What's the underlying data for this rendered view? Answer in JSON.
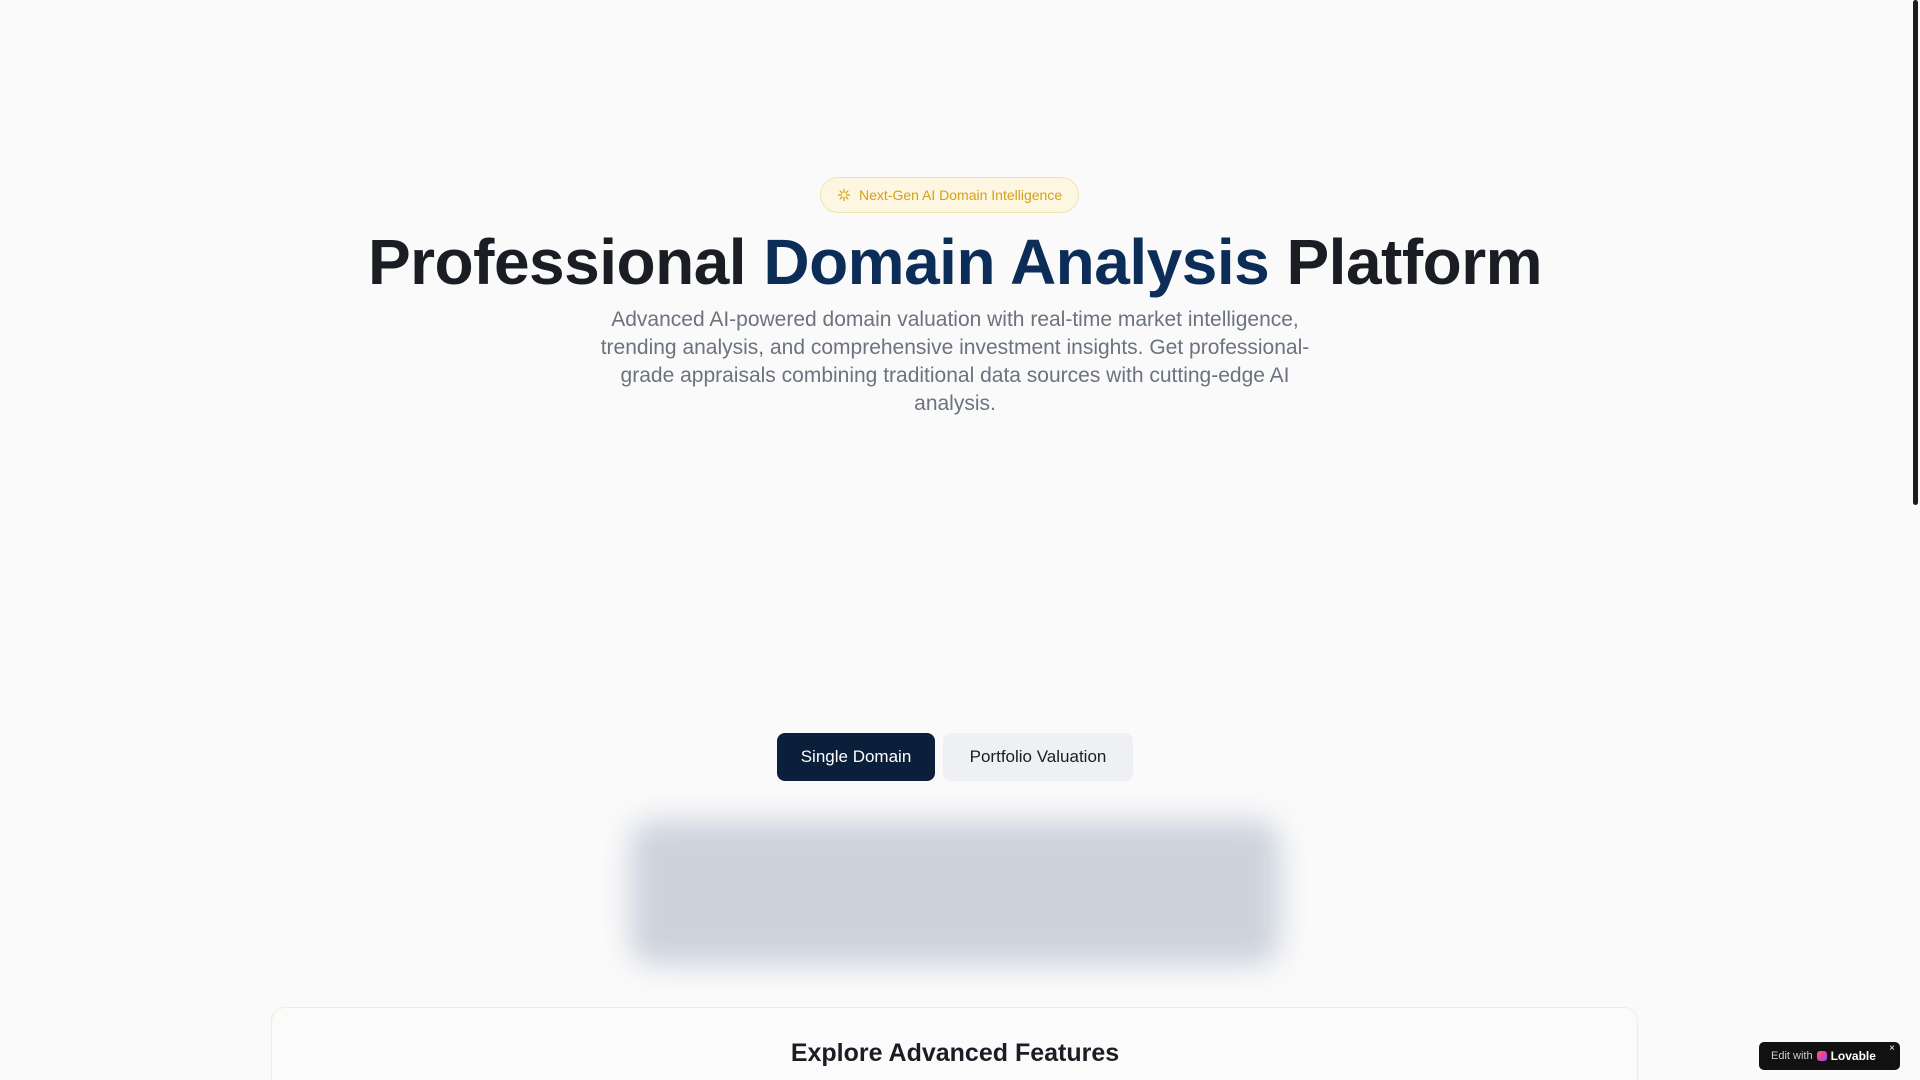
{
  "badge": {
    "label": "Next-Gen AI Domain Intelligence",
    "icon": "sparkles-icon",
    "color": "#d4a017"
  },
  "hero": {
    "title_prefix": "Professional ",
    "title_accent": "Domain Analysis",
    "title_suffix": " Platform",
    "accent_color": "#0b2d57",
    "subtitle": "Advanced AI-powered domain valuation with real-time market intelligence, trending analysis, and comprehensive investment insights. Get professional-grade appraisals combining traditional data sources with cutting-edge AI analysis."
  },
  "tabs": {
    "single_label": "Single Domain",
    "portfolio_label": "Portfolio Valuation",
    "active": "Single Domain",
    "active_color": "#0b1f3a"
  },
  "features": {
    "title": "Explore Advanced Features"
  },
  "lovable": {
    "edit_label": "Edit with",
    "brand_label": "Lovable",
    "close_label": "×"
  }
}
